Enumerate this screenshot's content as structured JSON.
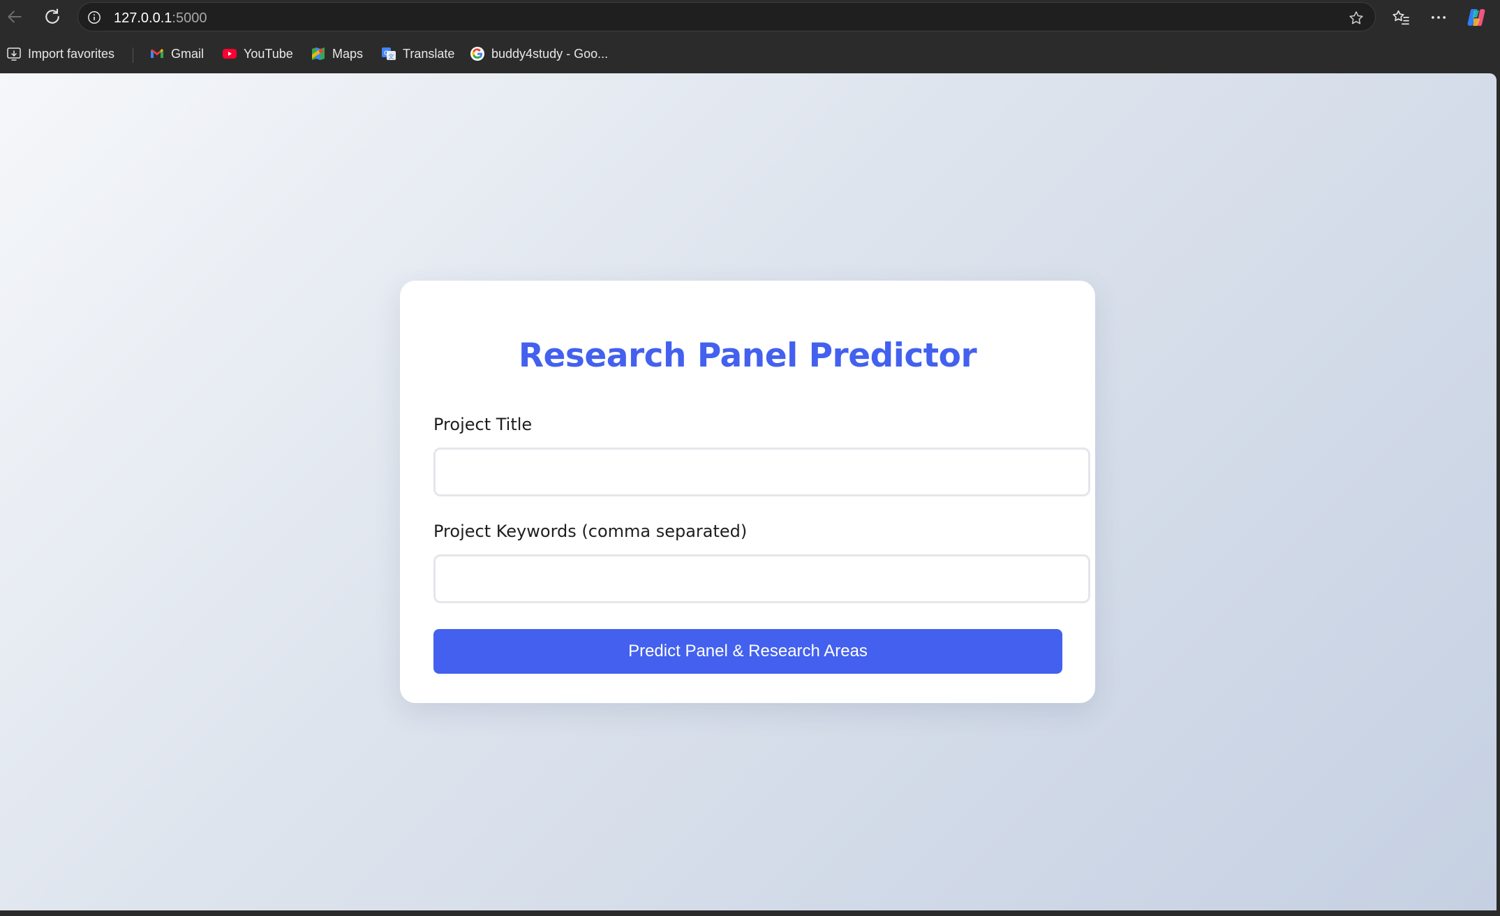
{
  "browser": {
    "url_host": "127.0.0.1",
    "url_port": ":5000",
    "bookmarks": [
      {
        "label": "Import favorites",
        "icon": "import-icon"
      },
      {
        "label": "Gmail",
        "icon": "gmail-icon"
      },
      {
        "label": "YouTube",
        "icon": "youtube-icon"
      },
      {
        "label": "Maps",
        "icon": "maps-icon"
      },
      {
        "label": "Translate",
        "icon": "translate-icon"
      },
      {
        "label": "buddy4study - Goo...",
        "icon": "google-icon"
      }
    ]
  },
  "form": {
    "title": "Research Panel Predictor",
    "project_title_label": "Project Title",
    "project_title_value": "",
    "keywords_label": "Project Keywords (comma separated)",
    "keywords_value": "",
    "submit_label": "Predict Panel & Research Areas"
  },
  "colors": {
    "accent": "#4361ee",
    "browser_chrome": "#2b2b2b"
  }
}
